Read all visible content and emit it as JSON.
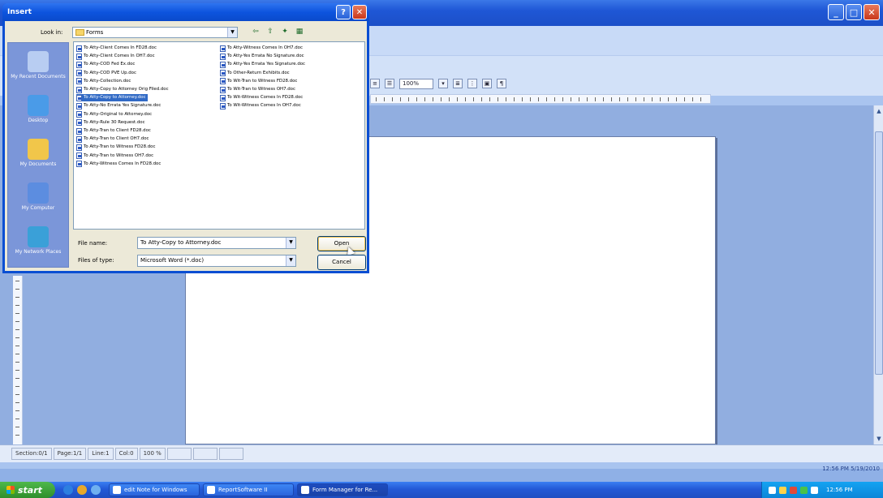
{
  "dialog": {
    "title": "Insert",
    "help_glyph": "?",
    "close_glyph": "✕",
    "look_in_label": "Look in:",
    "look_in_value": "Forms",
    "file_name_label": "File name:",
    "file_name_value": "To Atty-Copy to Attorney.doc",
    "file_type_label": "Files of type:",
    "file_type_value": "Microsoft Word (*.doc)",
    "open_label": "Open",
    "cancel_label": "Cancel",
    "places": [
      {
        "label": "My Recent Documents",
        "icon": "recent-documents-icon"
      },
      {
        "label": "Desktop",
        "icon": "desktop-icon"
      },
      {
        "label": "My Documents",
        "icon": "my-documents-icon"
      },
      {
        "label": "My Computer",
        "icon": "my-computer-icon"
      },
      {
        "label": "My Network Places",
        "icon": "network-places-icon"
      }
    ],
    "files_col1": [
      "To Atty-Client Comes In FD28.doc",
      "To Atty-Client Comes In OH7.doc",
      "To Atty-COD Fed Ex.doc",
      "To Atty-COD PVE Up.doc",
      "To Atty-Collection.doc",
      "To Atty-Copy to Attorney Orig Filed.doc",
      "To Atty-Copy to Attorney.doc",
      "To Atty-No Errata Yes Signature.doc",
      "To Atty-Original to Attorney.doc",
      "To Atty-Rule 30 Request.doc",
      "To Atty-Tran to Client FD28.doc",
      "To Atty-Tran to Client OH7.doc",
      "To Atty-Tran to Witness FD28.doc",
      "To Atty-Tran to Witness OH7.doc",
      "To Atty-Witness Comes In FD28.doc"
    ],
    "files_col2": [
      "To Atty-Witness Comes In OH7.doc",
      "To Atty-Yes Errata No Signature.doc",
      "To Atty-Yes Errata Yes Signature.doc",
      "To Other-Return Exhibits.doc",
      "To Wit-Tran to Witness FD28.doc",
      "To Wit-Tran to Witness OH7.doc",
      "To Wit-Witness Comes In FD28.doc",
      "To Wit-Witness Comes In OH7.doc"
    ],
    "selected_index_col1": 6
  },
  "app": {
    "minimize_glyph": "_",
    "maximize_glyph": "□",
    "close_glyph": "✕",
    "zoom": "100%",
    "status": {
      "section": "Section:0/1",
      "page": "Page:1/1",
      "line": "Line:1",
      "col": "Col:0",
      "zoom": "100 %"
    },
    "clock_strip": "12:56 PM  5/19/2010"
  },
  "taskbar": {
    "start_label": "start",
    "tasks": [
      "edit Note for Windows",
      "ReportSoftware II",
      "Form Manager for Re..."
    ],
    "clock": "12:56 PM"
  }
}
